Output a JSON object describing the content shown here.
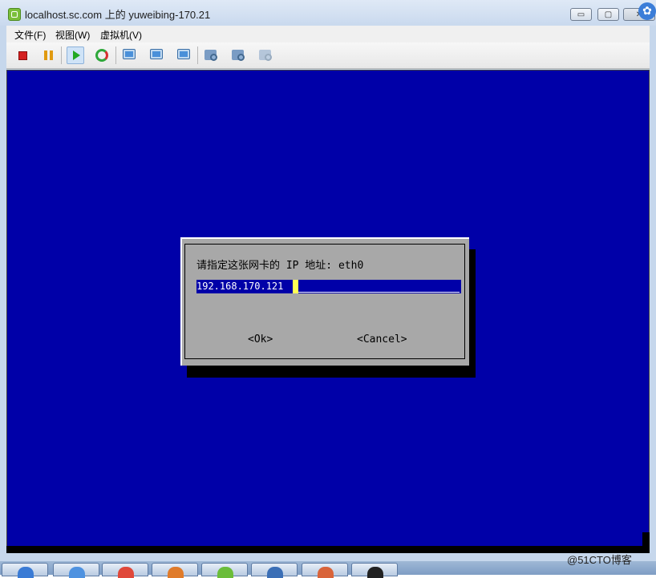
{
  "window": {
    "title": "localhost.sc.com 上的 yuweibing-170.21",
    "min_glyph": "▭",
    "max_glyph": "▢",
    "close_glyph": "✕",
    "corner_glyph": "✿"
  },
  "menubar": {
    "items": [
      {
        "label": "文件(F)"
      },
      {
        "label": "视图(W)"
      },
      {
        "label": "虚拟机(V)"
      }
    ]
  },
  "toolbar": {
    "icons": [
      "stop-icon",
      "pause-icon",
      "play-icon",
      "reset-icon",
      "snapshot-icon",
      "revert-snapshot-icon",
      "snapshot-manager-icon",
      "vm-settings-icon",
      "edit-settings-icon",
      "disabled-settings-icon"
    ]
  },
  "colors": {
    "console_bg": "#0000a8",
    "dialog_bg": "#a8a8a8",
    "field_bg": "#0000a8",
    "cursor": "#ffff55"
  },
  "dialog": {
    "prompt": "请指定这张网卡的 IP 地址: eth0",
    "ip_value": "192.168.170.121",
    "ok_label": "<Ok>",
    "cancel_label": "<Cancel>"
  },
  "watermark": "@51CTO博客"
}
